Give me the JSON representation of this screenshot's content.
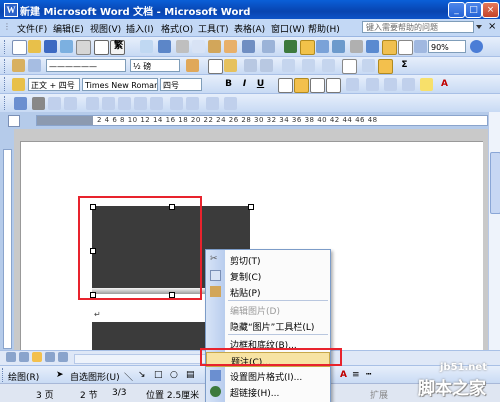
{
  "window": {
    "title": "新建 Microsoft Word 文档 - Microsoft Word",
    "app_icon": "W"
  },
  "menu": {
    "items": [
      "文件(F)",
      "编辑(E)",
      "视图(V)",
      "插入(I)",
      "格式(O)",
      "工具(T)",
      "表格(A)",
      "窗口(W)",
      "帮助(H)"
    ],
    "help_placeholder": "键入需要帮助的问题",
    "close_doc": "×"
  },
  "toolbar": {
    "font_style": "繁",
    "zoom": "90%",
    "line_spacing": "½ 磅",
    "style": "正文 + 四号",
    "font": "Times New Roman",
    "size": "四号",
    "bold": "B",
    "italic": "I",
    "underline": "U",
    "font_color_letter": "A"
  },
  "ruler": {
    "numbers": "2 4 6 8 10 12 14 16 18 20 22 24 26 28 30 32 34 36 38 40 42 44 46 48"
  },
  "drawing_toolbar": {
    "draw_label": "绘图(R)",
    "autoshapes_label": "自选图形(U)"
  },
  "status_bar": {
    "page": "3 页",
    "section": "2 节",
    "page_of": "3/3",
    "position": "位置 2.5厘米",
    "ext": "扩展"
  },
  "context_menu": {
    "items": [
      {
        "label": "剪切(T)",
        "icon": "scissors-icon",
        "enabled": true
      },
      {
        "label": "复制(C)",
        "icon": "copy-icon",
        "enabled": true
      },
      {
        "label": "粘贴(P)",
        "icon": "paste-icon",
        "enabled": true
      },
      {
        "label": "编辑图片(D)",
        "icon": "",
        "enabled": false
      },
      {
        "label": "隐藏“图片”工具栏(L)",
        "icon": "",
        "enabled": true
      },
      {
        "label": "边框和底纹(B)...",
        "icon": "",
        "enabled": true
      },
      {
        "label": "题注(C)...",
        "icon": "",
        "enabled": true,
        "highlighted": true
      },
      {
        "label": "设置图片格式(I)...",
        "icon": "format-picture-icon",
        "enabled": true
      },
      {
        "label": "超链接(H)...",
        "icon": "hyperlink-icon",
        "enabled": true
      }
    ]
  },
  "paragraph_mark": "↵",
  "watermark": {
    "site": "jb51.net",
    "name": "脚本之家"
  },
  "colors": {
    "title_bar": "#0844b0",
    "highlight": "#f7e3a3",
    "red_annotation": "#e8232d",
    "image_fill": "#3b3b3b"
  }
}
